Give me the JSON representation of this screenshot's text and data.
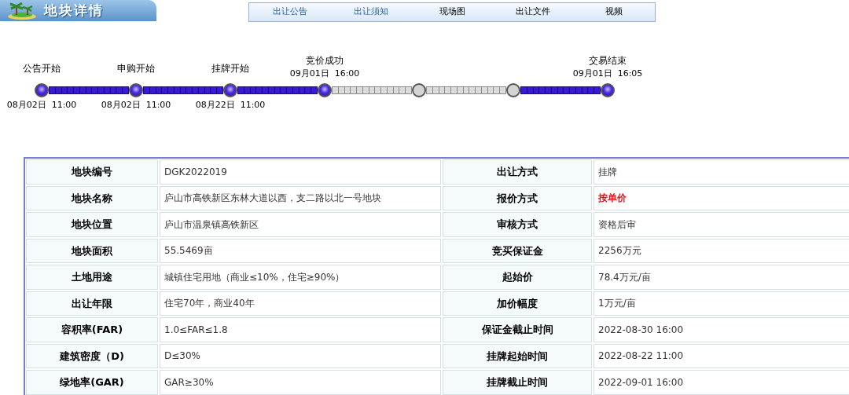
{
  "header": {
    "title": "地块详情"
  },
  "tabs": [
    {
      "label": "出让公告",
      "visited": true
    },
    {
      "label": "出让须知",
      "visited": true
    },
    {
      "label": "现场图",
      "visited": false
    },
    {
      "label": "出让文件",
      "visited": false
    },
    {
      "label": "视频",
      "visited": false
    }
  ],
  "timeline": {
    "nodes": [
      {
        "label": "公告开始",
        "date_below": "08月02日  11:00",
        "done": true
      },
      {
        "label": "申购开始",
        "date_below": "08月02日  11:00",
        "done": true
      },
      {
        "label": "挂牌开始",
        "date_below": "08月22日  11:00",
        "done": true
      },
      {
        "label": "竞价成功",
        "date_above": "09月01日  16:00",
        "done": true
      },
      {
        "done": false
      },
      {
        "done": false
      },
      {
        "label": "交易结束",
        "date_above": "09月01日  16:05",
        "done": true
      }
    ],
    "segments": [
      {
        "done": true
      },
      {
        "done": true
      },
      {
        "done": true
      },
      {
        "done": false
      },
      {
        "done": false
      },
      {
        "done": true
      }
    ]
  },
  "table": {
    "rows": [
      [
        {
          "label": "地块编号",
          "value": "DGK2022019",
          "emphasis": false
        },
        {
          "label": "出让方式",
          "value": "挂牌",
          "emphasis": false
        }
      ],
      [
        {
          "label": "地块名称",
          "value": "庐山市高铁新区东林大道以西，支二路以北一号地块",
          "emphasis": false
        },
        {
          "label": "报价方式",
          "value": "按单价",
          "emphasis": true
        }
      ],
      [
        {
          "label": "地块位置",
          "value": "庐山市温泉镇高铁新区",
          "emphasis": false
        },
        {
          "label": "审核方式",
          "value": "资格后审",
          "emphasis": false
        }
      ],
      [
        {
          "label": "地块面积",
          "value": "55.5469亩",
          "emphasis": false
        },
        {
          "label": "竞买保证金",
          "value": "2256万元",
          "emphasis": false
        }
      ],
      [
        {
          "label": "土地用途",
          "value": "城镇住宅用地（商业≤10%，住宅≥90%）",
          "emphasis": false
        },
        {
          "label": "起始价",
          "value": "78.4万元/亩",
          "emphasis": false
        }
      ],
      [
        {
          "label": "出让年限",
          "value": "住宅70年，商业40年",
          "emphasis": false
        },
        {
          "label": "加价幅度",
          "value": "1万元/亩",
          "emphasis": false
        }
      ],
      [
        {
          "label": "容积率(FAR)",
          "value": "1.0≤FAR≤1.8",
          "emphasis": false
        },
        {
          "label": "保证金截止时间",
          "value": "2022-08-30 16:00",
          "emphasis": false
        }
      ],
      [
        {
          "label": "建筑密度（D)",
          "value": "D≤30%",
          "emphasis": false
        },
        {
          "label": "挂牌起始时间",
          "value": "2022-08-22 11:00",
          "emphasis": false
        }
      ],
      [
        {
          "label": "绿地率(GAR)",
          "value": "GAR≥30%",
          "emphasis": false
        },
        {
          "label": "挂牌截止时间",
          "value": "2022-09-01 16:00",
          "emphasis": false
        }
      ]
    ]
  }
}
